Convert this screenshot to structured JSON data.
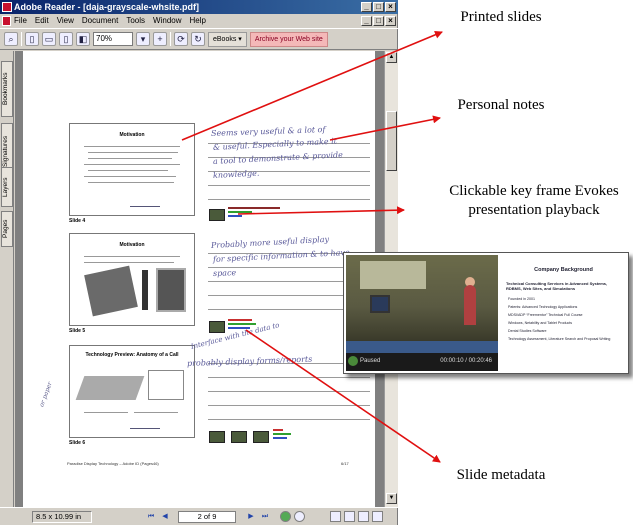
{
  "window": {
    "title": "Adobe Reader - [daja-grayscale-whsite.pdf]",
    "controls": [
      "_",
      "□",
      "×"
    ]
  },
  "menu": {
    "items": [
      "File",
      "Edit",
      "View",
      "Document",
      "Tools",
      "Window",
      "Help"
    ]
  },
  "toolbar": {
    "zoom": "70%",
    "ebooks_label": "eBooks",
    "archive_label": "Archive your Web site"
  },
  "side_tabs": [
    "Bookmarks",
    "Signatures",
    "Layers",
    "Pages"
  ],
  "slides": [
    {
      "label": "Slide 4",
      "title": "Motivation",
      "notes": [
        "Seems very useful & a lot of",
        "& useful. Especially to make it",
        "a tool to demonstrate & provide",
        "knowledge."
      ]
    },
    {
      "label": "Slide 5",
      "title": "Motivation",
      "notes": [
        "Probably more useful display",
        "for specific information & to have",
        "space"
      ]
    },
    {
      "label": "Slide 6",
      "title": "Technology Preview: Anatomy of a Call",
      "notes": [
        "Interface with the data to",
        "probably display forms/reports",
        "or paper"
      ]
    }
  ],
  "page_footer": {
    "left": "Paradise Display Technology – Adobe ID (Pages46)",
    "right": "6/17"
  },
  "statusbar": {
    "page_size": "8.5 x 10.99 in",
    "page": "2 of 9"
  },
  "annotations": {
    "printed_slides": "Printed slides",
    "personal_notes": "Personal notes",
    "key_frame": "Clickable key frame Evokes presentation playback",
    "slide_metadata": "Slide metadata"
  },
  "video_popup": {
    "status": "Paused",
    "time": "00:00:10 / 00:20:46",
    "slide_title": "Company Background",
    "slide_subtitle": "Technical Consulting Services in Advanced Systems, RDBMS, Web Sites, and Simulations",
    "slide_items": [
      "Founded in 2001",
      "Patents: Advanced Technology Applications",
      "MDSI/ADP “Freementor” Technical Full Course",
      "Windows, Netability and Tablet Products",
      "Dental Studies Software",
      "Technology Assessment, Literature Search and Proposal Writing"
    ]
  },
  "colors": {
    "title_bar_start": "#0a246a",
    "title_bar_end": "#3a6ea5",
    "arrow": "#e01010",
    "metadata_red": "#c83030",
    "metadata_green": "#30a030",
    "metadata_blue": "#3050c0"
  }
}
